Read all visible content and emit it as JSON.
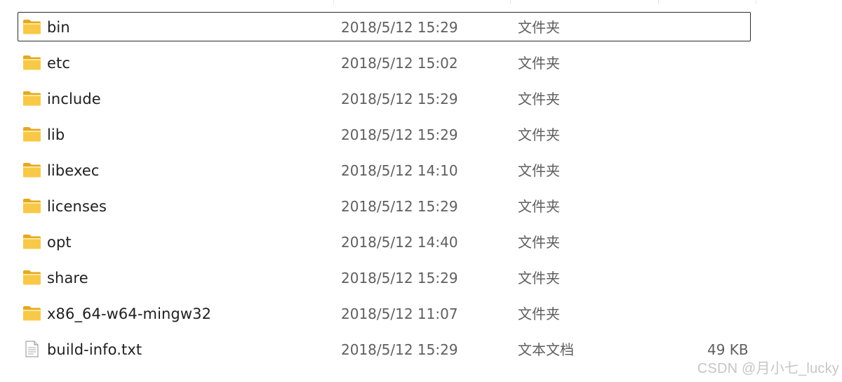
{
  "files": [
    {
      "name": "bin",
      "date": "2018/5/12 15:29",
      "type": "文件夹",
      "size": "",
      "icon": "folder-icon",
      "focused": true
    },
    {
      "name": "etc",
      "date": "2018/5/12 15:02",
      "type": "文件夹",
      "size": "",
      "icon": "folder-icon",
      "focused": false
    },
    {
      "name": "include",
      "date": "2018/5/12 15:29",
      "type": "文件夹",
      "size": "",
      "icon": "folder-icon",
      "focused": false
    },
    {
      "name": "lib",
      "date": "2018/5/12 15:29",
      "type": "文件夹",
      "size": "",
      "icon": "folder-icon",
      "focused": false
    },
    {
      "name": "libexec",
      "date": "2018/5/12 14:10",
      "type": "文件夹",
      "size": "",
      "icon": "folder-icon",
      "focused": false
    },
    {
      "name": "licenses",
      "date": "2018/5/12 15:29",
      "type": "文件夹",
      "size": "",
      "icon": "folder-icon",
      "focused": false
    },
    {
      "name": "opt",
      "date": "2018/5/12 14:40",
      "type": "文件夹",
      "size": "",
      "icon": "folder-icon",
      "focused": false
    },
    {
      "name": "share",
      "date": "2018/5/12 15:29",
      "type": "文件夹",
      "size": "",
      "icon": "folder-icon",
      "focused": false
    },
    {
      "name": "x86_64-w64-mingw32",
      "date": "2018/5/12 11:07",
      "type": "文件夹",
      "size": "",
      "icon": "folder-icon",
      "focused": false
    },
    {
      "name": "build-info.txt",
      "date": "2018/5/12 15:29",
      "type": "文本文档",
      "size": "49 KB",
      "icon": "text-file-icon",
      "focused": false
    }
  ],
  "watermark": "CSDN @月小七_lucky",
  "colors": {
    "folder_body": "#f8c948",
    "folder_back": "#e5a821",
    "focus_border": "#2b2b2b",
    "secondary_text": "#5f5f5f"
  }
}
